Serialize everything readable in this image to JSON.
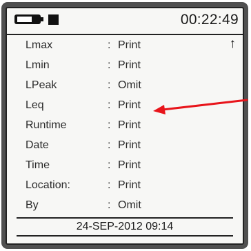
{
  "status_bar": {
    "battery_icon": "battery-icon",
    "record_icon": "square-icon",
    "clock": "00:22:49"
  },
  "print_options": [
    {
      "label": "Lmax",
      "separator": ":",
      "value": "Print"
    },
    {
      "label": "Lmin",
      "separator": ":",
      "value": "Print"
    },
    {
      "label": "LPeak",
      "separator": ":",
      "value": "Omit"
    },
    {
      "label": "Leq",
      "separator": ":",
      "value": "Print"
    },
    {
      "label": "Runtime",
      "separator": ":",
      "value": "Print"
    },
    {
      "label": "Date",
      "separator": ":",
      "value": "Print"
    },
    {
      "label": "Time",
      "separator": ":",
      "value": "Print"
    },
    {
      "label": "Location:",
      "separator": ":",
      "value": "Print"
    },
    {
      "label": "By",
      "separator": ":",
      "value": "Omit"
    }
  ],
  "scroll_indicator": "↑",
  "footer": {
    "datetime": "24-SEP-2012  09:14"
  },
  "annotation": {
    "arrow_color": "#e8141a",
    "points_to": "Leq"
  },
  "colors": {
    "device_body": "#505050",
    "screen": "#f7f7f5",
    "text": "#2a2a2a"
  }
}
